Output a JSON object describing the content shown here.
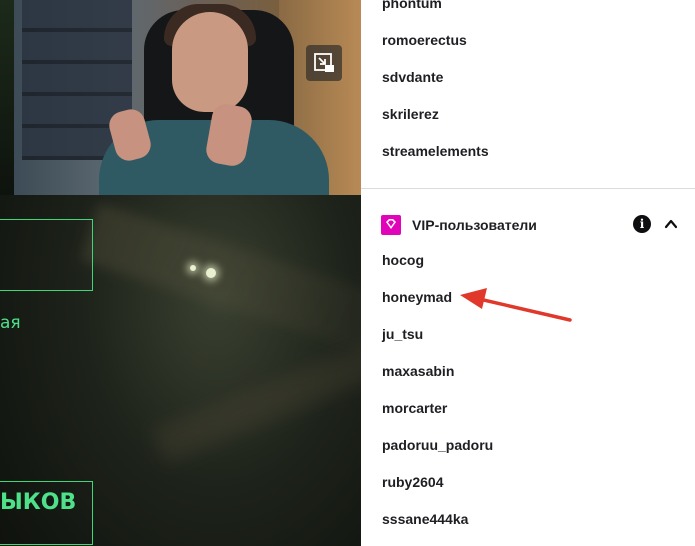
{
  "stream": {
    "game_text_right": "ая",
    "game_text_bottom": "ЫКОВ"
  },
  "viewers": {
    "top_list": [
      "phontum",
      "romoerectus",
      "sdvdante",
      "skrilerez",
      "streamelements"
    ],
    "vip_section": {
      "title": "VIP-пользователи",
      "badge_color": "#e005b9",
      "info_icon": "info-icon",
      "collapse_icon": "chevron-up-icon",
      "users": [
        "hocog",
        "honeymad",
        "ju_tsu",
        "maxasabin",
        "morcarter",
        "padoruu_padoru",
        "ruby2604",
        "sssane444ka"
      ]
    }
  },
  "annotation": {
    "arrow_color": "#e0392b",
    "points_to": "honeymad"
  }
}
